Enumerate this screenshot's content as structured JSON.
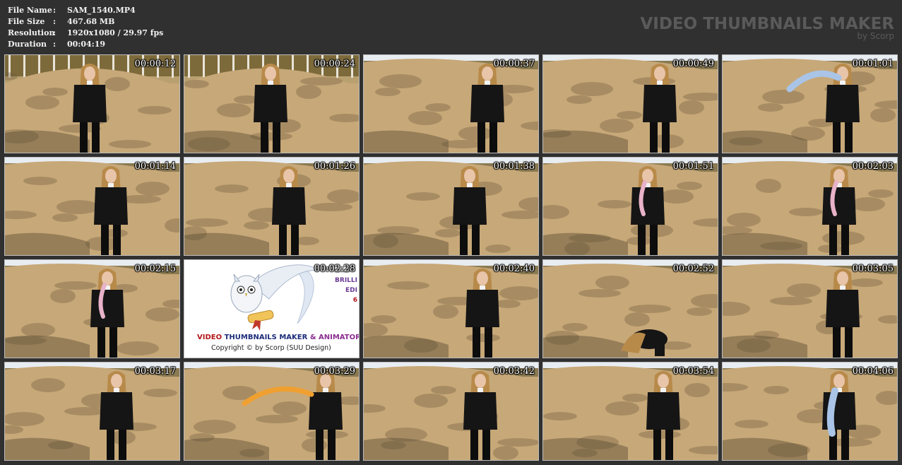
{
  "file_info": [
    {
      "label": "File Name",
      "value": "SAM_1540.MP4"
    },
    {
      "label": "File Size",
      "value": "467.68 MB"
    },
    {
      "label": "Resolution",
      "value": "1920x1080 / 29.97 fps"
    },
    {
      "label": "Duration",
      "value": "00:04:19"
    }
  ],
  "separator": ":",
  "brand": {
    "title": "VIDEO THUMBNAILS MAKER",
    "subtitle": "by Scorp"
  },
  "logo_panel": {
    "title_video": "VIDEO",
    "title_thumbs": "THUMBNAILS MAKER",
    "title_amp": "&",
    "title_anim": "ANIMATOR",
    "copyright": "Copyright © by Scorp (SUU Design)",
    "edition_1": "BRILLI",
    "edition_2": "EDI",
    "edition_3": "6"
  },
  "thumbnails": [
    {
      "time": "00:00:12"
    },
    {
      "time": "00:00:24"
    },
    {
      "time": "00:00:37"
    },
    {
      "time": "00:00:49"
    },
    {
      "time": "00:01:01"
    },
    {
      "time": "00:01:14"
    },
    {
      "time": "00:01:26"
    },
    {
      "time": "00:01:38"
    },
    {
      "time": "00:01:51"
    },
    {
      "time": "00:02:03"
    },
    {
      "time": "00:02:15"
    },
    {
      "time": "00:02:28"
    },
    {
      "time": "00:02:40"
    },
    {
      "time": "00:02:52"
    },
    {
      "time": "00:03:05"
    },
    {
      "time": "00:03:17"
    },
    {
      "time": "00:03:29"
    },
    {
      "time": "00:03:42"
    },
    {
      "time": "00:03:54"
    },
    {
      "time": "00:04:06"
    }
  ],
  "colors": {
    "background": "#303030",
    "sand": "#c7a878",
    "shadow": "#6e5a3c",
    "jacket": "#151515",
    "hair": "#b88a4a",
    "balloon_blue": "#a9c4e6",
    "balloon_orange": "#f0a030",
    "balloon_pink": "#e8b2c8"
  }
}
